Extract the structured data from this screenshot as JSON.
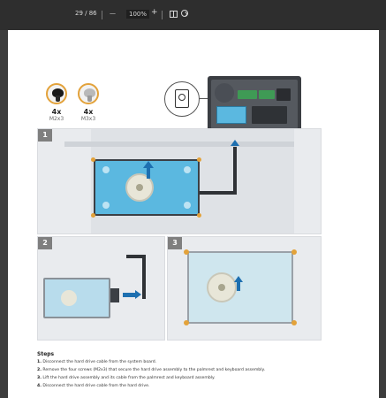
{
  "toolbar": {
    "page_indicator": "29 / 86",
    "zoom_out": "—",
    "zoom_level": "100%",
    "zoom_in": "+"
  },
  "screws": [
    {
      "qty": "4x",
      "type": "M2x3"
    },
    {
      "qty": "4x",
      "type": "M3x3"
    }
  ],
  "step_panels": [
    "1",
    "2",
    "3"
  ],
  "steps": {
    "title": "Steps",
    "items": [
      {
        "num": "1.",
        "text": "Disconnect the hard drive cable from the system board."
      },
      {
        "num": "2.",
        "text": "Remove the four screws (M2x3) that secure the hard drive assembly to the palmrest and keyboard assembly."
      },
      {
        "num": "3.",
        "text": "Lift the hard drive assembly and its cable from the palmrest and keyboard assembly."
      },
      {
        "num": "4.",
        "text": "Disconnect the hard drive cable from the hard drive."
      }
    ]
  },
  "colors": {
    "toolbar_bg": "#2e2e2e",
    "panel_bg": "#e9ebee",
    "hdd_blue": "#5bb8e0",
    "screw_ring": "#e3a23a"
  }
}
